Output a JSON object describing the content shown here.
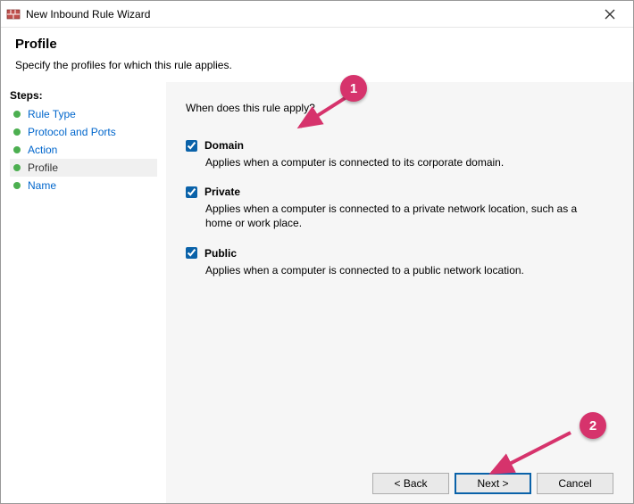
{
  "window": {
    "title": "New Inbound Rule Wizard"
  },
  "header": {
    "title": "Profile",
    "subtitle": "Specify the profiles for which this rule applies."
  },
  "sidebar": {
    "title": "Steps:",
    "items": [
      {
        "label": "Rule Type"
      },
      {
        "label": "Protocol and Ports"
      },
      {
        "label": "Action"
      },
      {
        "label": "Profile"
      },
      {
        "label": "Name"
      }
    ]
  },
  "content": {
    "question": "When does this rule apply?",
    "options": [
      {
        "label": "Domain",
        "checked": true,
        "desc": "Applies when a computer is connected to its corporate domain."
      },
      {
        "label": "Private",
        "checked": true,
        "desc": "Applies when a computer is connected to a private network location, such as a home or work place."
      },
      {
        "label": "Public",
        "checked": true,
        "desc": "Applies when a computer is connected to a public network location."
      }
    ]
  },
  "footer": {
    "back": "< Back",
    "next": "Next >",
    "cancel": "Cancel"
  },
  "callouts": {
    "one": "1",
    "two": "2"
  }
}
